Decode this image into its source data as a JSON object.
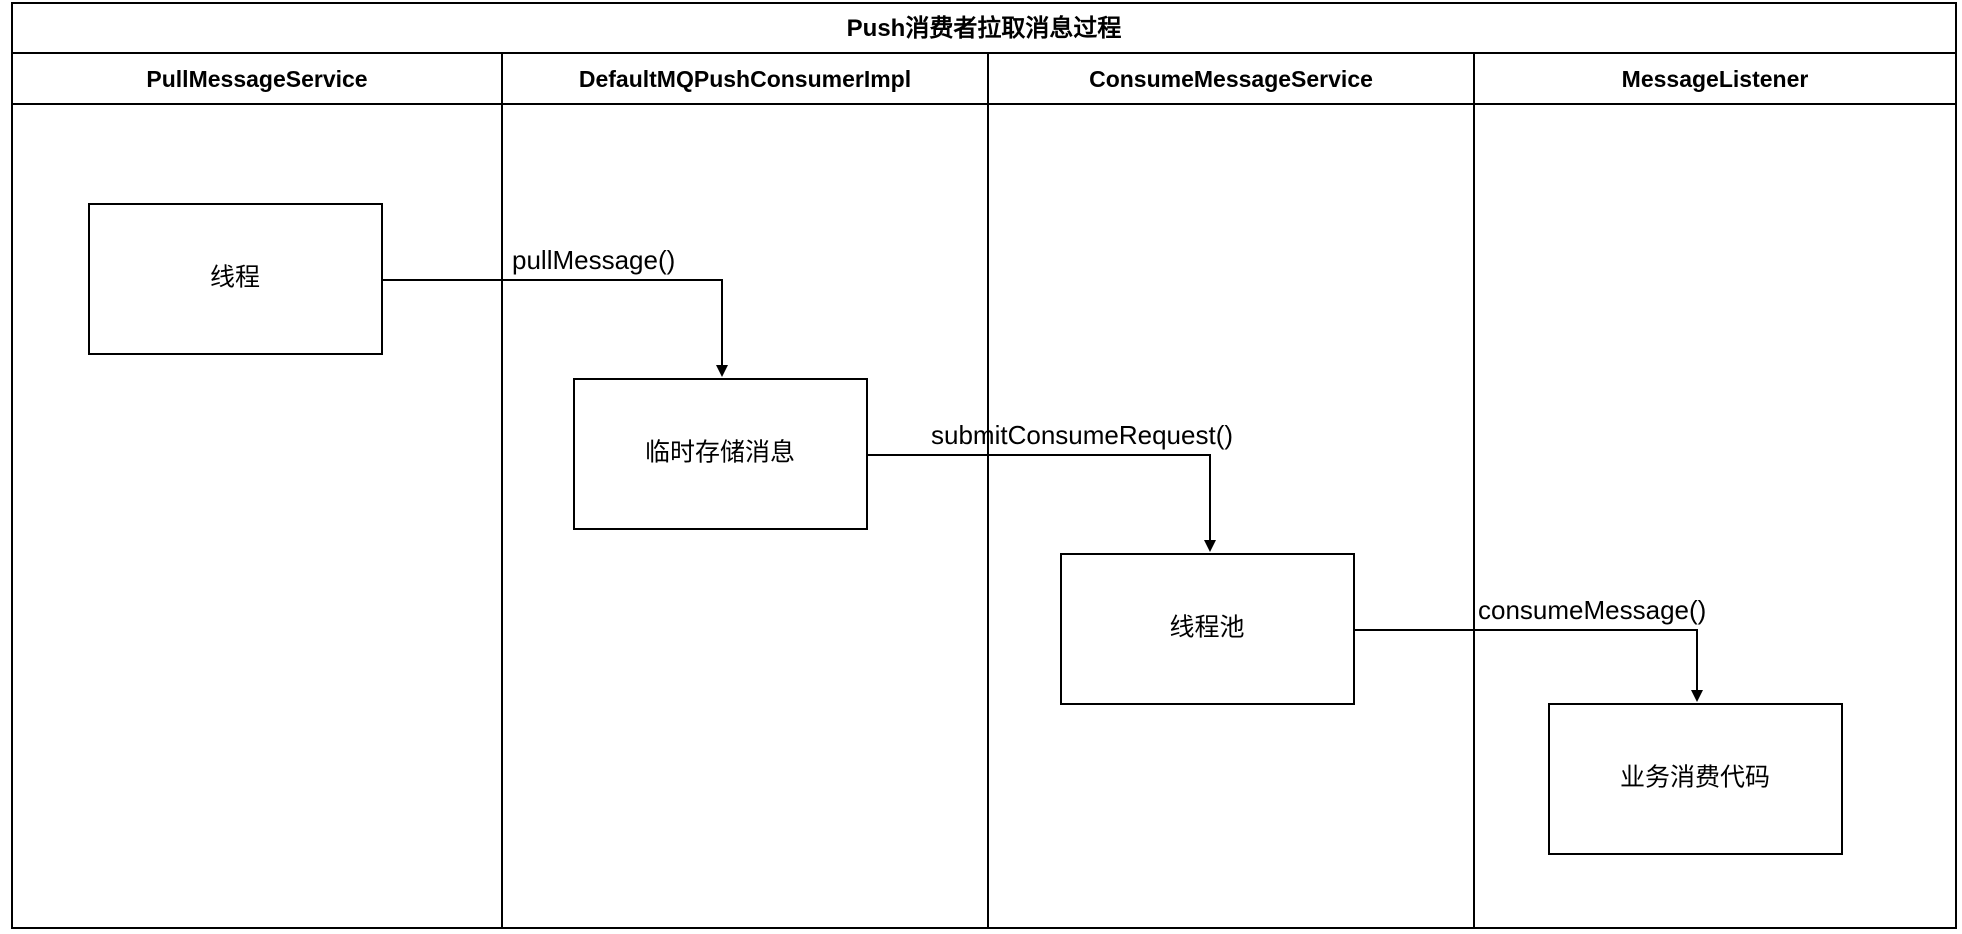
{
  "diagram": {
    "title": "Push消费者拉取消息过程",
    "lanes": [
      {
        "label": "PullMessageService"
      },
      {
        "label": "DefaultMQPushConsumerImpl"
      },
      {
        "label": "ConsumeMessageService"
      },
      {
        "label": "MessageListener"
      }
    ],
    "nodes": [
      {
        "label": "线程"
      },
      {
        "label": "临时存储消息"
      },
      {
        "label": "线程池"
      },
      {
        "label": "业务消费代码"
      }
    ],
    "edges": [
      {
        "label": "pullMessage()"
      },
      {
        "label": "submitConsumeRequest()"
      },
      {
        "label": "consumeMessage()"
      }
    ]
  }
}
